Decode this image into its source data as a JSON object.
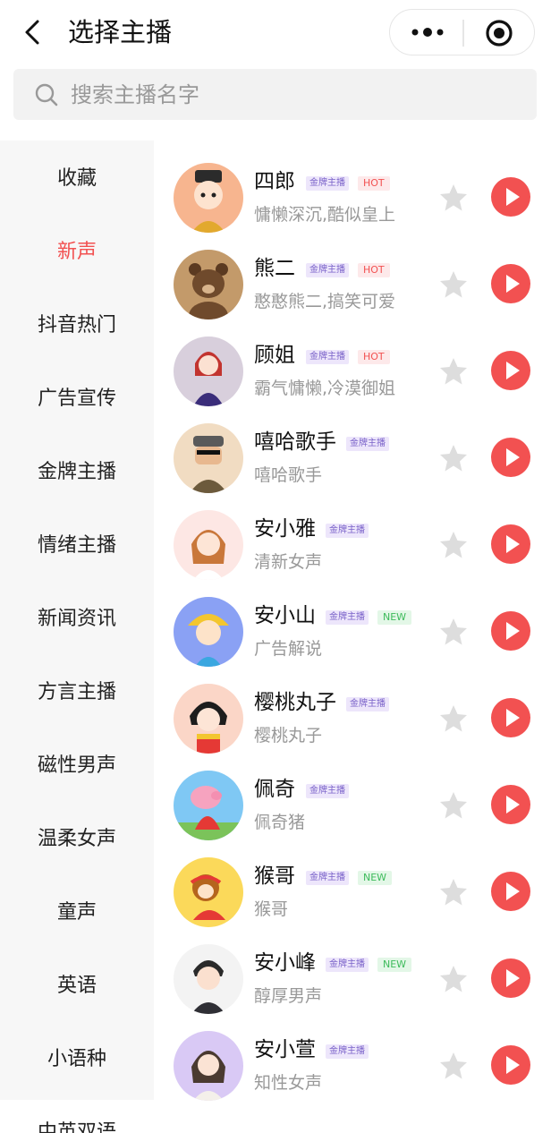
{
  "header": {
    "title": "选择主播"
  },
  "search": {
    "placeholder": "搜索主播名字"
  },
  "categories": [
    "收藏",
    "新声",
    "抖音热门",
    "广告宣传",
    "金牌主播",
    "情绪主播",
    "新闻资讯",
    "方言主播",
    "磁性男声",
    "温柔女声",
    "童声",
    "英语",
    "小语种",
    "中英双语"
  ],
  "active_category": "新声",
  "voices": [
    {
      "name": "四郎",
      "badges": [
        {
          "text": "金牌主播",
          "type": "gold"
        },
        {
          "text": "HOT",
          "type": "hot"
        }
      ],
      "desc": "慵懒深沉,酷似皇上",
      "avatar_bg": "#f7b58f"
    },
    {
      "name": "熊二",
      "badges": [
        {
          "text": "金牌主播",
          "type": "gold"
        },
        {
          "text": "HOT",
          "type": "hot"
        }
      ],
      "desc": "憨憨熊二,搞笑可爱",
      "avatar_bg": "#c39a6a"
    },
    {
      "name": "顾姐",
      "badges": [
        {
          "text": "金牌主播",
          "type": "gold"
        },
        {
          "text": "HOT",
          "type": "hot"
        }
      ],
      "desc": "霸气慵懒,冷漠御姐",
      "avatar_bg": "#d8cfdc"
    },
    {
      "name": "嘻哈歌手",
      "badges": [
        {
          "text": "金牌主播",
          "type": "gold"
        }
      ],
      "desc": "嘻哈歌手",
      "avatar_bg": "#f1dcc2"
    },
    {
      "name": "安小雅",
      "badges": [
        {
          "text": "金牌主播",
          "type": "gold"
        }
      ],
      "desc": "清新女声",
      "avatar_bg": "#fde7e4"
    },
    {
      "name": "安小山",
      "badges": [
        {
          "text": "金牌主播",
          "type": "gold"
        },
        {
          "text": "NEW",
          "type": "new"
        }
      ],
      "desc": "广告解说",
      "avatar_bg": "#8aa1f4"
    },
    {
      "name": "樱桃丸子",
      "badges": [
        {
          "text": "金牌主播",
          "type": "gold"
        }
      ],
      "desc": "樱桃丸子",
      "avatar_bg": "#fbd6c7"
    },
    {
      "name": "佩奇",
      "badges": [
        {
          "text": "金牌主播",
          "type": "gold"
        }
      ],
      "desc": "佩奇猪",
      "avatar_bg": "#7fc8f4"
    },
    {
      "name": "猴哥",
      "badges": [
        {
          "text": "金牌主播",
          "type": "gold"
        },
        {
          "text": "NEW",
          "type": "new"
        }
      ],
      "desc": "猴哥",
      "avatar_bg": "#fbd95a"
    },
    {
      "name": "安小峰",
      "badges": [
        {
          "text": "金牌主播",
          "type": "gold"
        },
        {
          "text": "NEW",
          "type": "new"
        }
      ],
      "desc": "醇厚男声",
      "avatar_bg": "#f3f3f3"
    },
    {
      "name": "安小萱",
      "badges": [
        {
          "text": "金牌主播",
          "type": "gold"
        }
      ],
      "desc": "知性女声",
      "avatar_bg": "#d9c9f5"
    }
  ],
  "colors": {
    "accent": "#f25151",
    "star": "#dddddd",
    "sidebar_bg": "#f7f7f7"
  },
  "icons": {
    "back": "chevron-left-icon",
    "more": "more-dots-icon",
    "close": "mini-program-close-icon",
    "search": "search-icon",
    "star": "star-icon",
    "play": "play-icon"
  }
}
